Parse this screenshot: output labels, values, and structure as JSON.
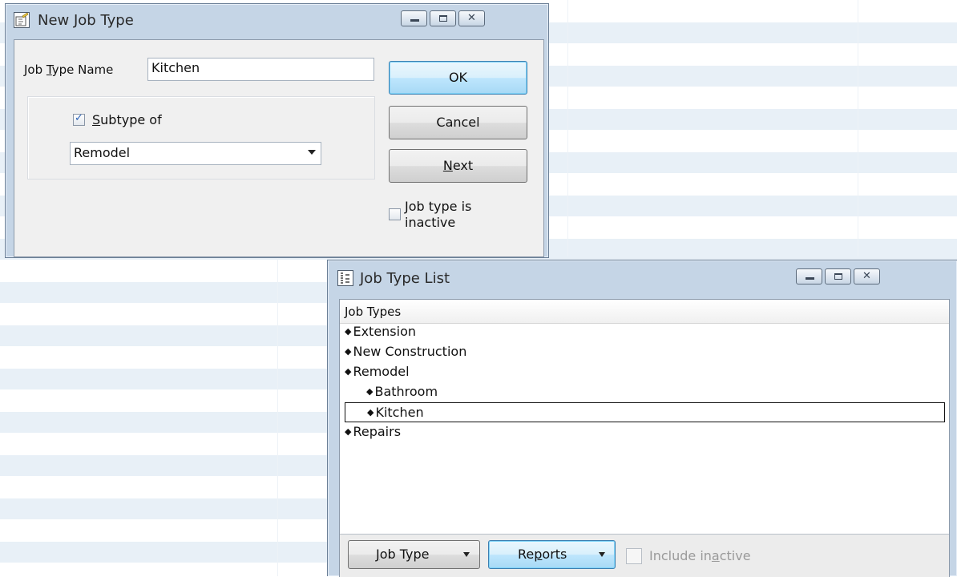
{
  "new_job_type": {
    "title": "New Job Type",
    "name_label_pre": "Job ",
    "name_label_ul": "T",
    "name_label_post": "ype Name",
    "name_value": "Kitchen",
    "subtype_checked": true,
    "subtype_label_ul": "S",
    "subtype_label_post": "ubtype of",
    "subtype_parent": "Remodel",
    "ok_label": "OK",
    "cancel_label": "Cancel",
    "next_label_ul": "N",
    "next_label_post": "ext",
    "inactive_checked": false,
    "inactive_label_line1": "Job type is",
    "inactive_label_line2": "inactive"
  },
  "job_type_list": {
    "title": "Job Type List",
    "column_header": "Job Types",
    "items": [
      {
        "label": "Extension",
        "level": 0
      },
      {
        "label": "New Construction",
        "level": 0
      },
      {
        "label": "Remodel",
        "level": 0
      },
      {
        "label": "Bathroom",
        "level": 1
      },
      {
        "label": "Kitchen",
        "level": 1,
        "selected": true
      },
      {
        "label": "Repairs",
        "level": 0
      }
    ],
    "footer": {
      "job_type_btn_ul": "J",
      "job_type_btn_post": "ob Type",
      "reports_btn_pre": "Re",
      "reports_btn_ul": "p",
      "reports_btn_post": "orts",
      "include_inactive_pre": "Include in",
      "include_inactive_ul": "a",
      "include_inactive_post": "ctive"
    }
  },
  "colors": {
    "window_frame": "#c5d5e6",
    "stripe": "#e8f0f7",
    "default_button": "#bee6fd"
  }
}
